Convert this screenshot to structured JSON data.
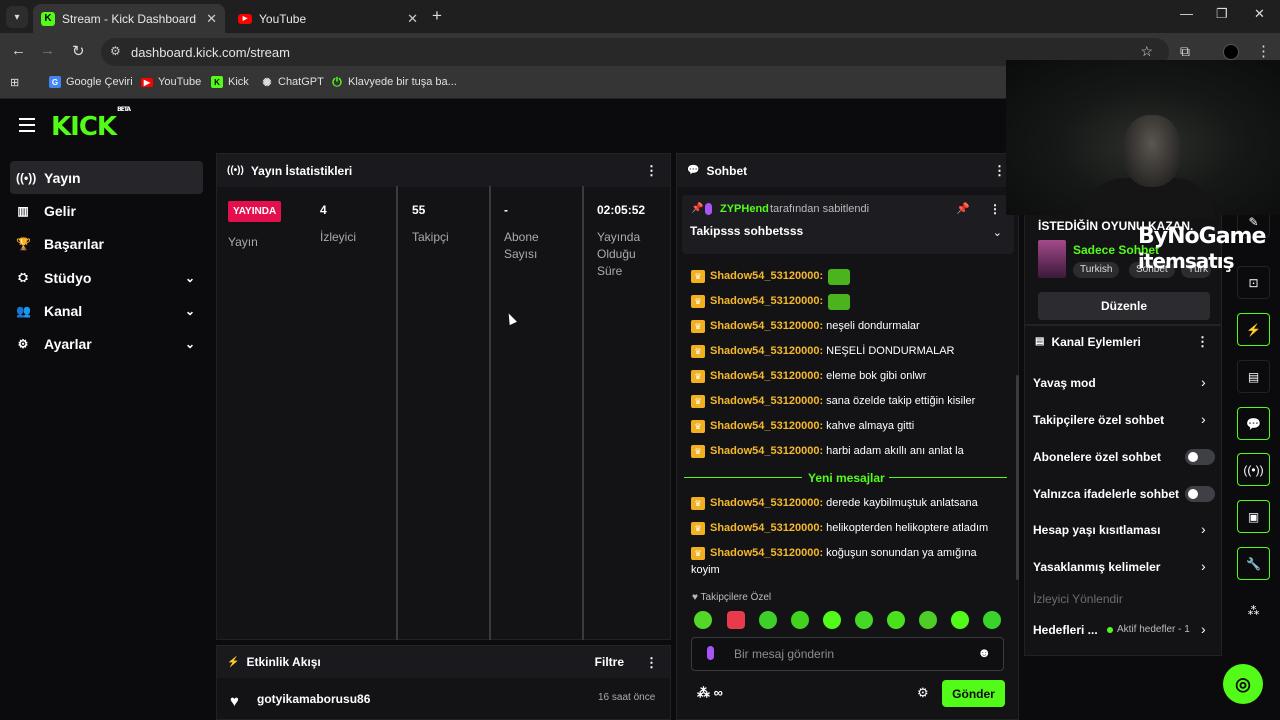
{
  "browser": {
    "tabs": [
      {
        "title": "Stream - Kick Dashboard",
        "active": true
      },
      {
        "title": "YouTube",
        "active": false
      }
    ],
    "url": "dashboard.kick.com/stream",
    "bookmarks": [
      "Google Çeviri",
      "YouTube",
      "Kick",
      "ChatGPT",
      "Klavyede bir tuşa ba..."
    ]
  },
  "brand": {
    "logo": "KICK",
    "beta": "BETA",
    "accent": "#53fc18"
  },
  "sidebar": {
    "items": [
      {
        "label": "Yayın",
        "icon": "broadcast-icon"
      },
      {
        "label": "Gelir",
        "icon": "chart-icon"
      },
      {
        "label": "Başarılar",
        "icon": "trophy-icon"
      },
      {
        "label": "Stüdyo",
        "icon": "studio-icon"
      },
      {
        "label": "Kanal",
        "icon": "users-icon"
      },
      {
        "label": "Ayarlar",
        "icon": "gear-icon"
      }
    ]
  },
  "stats": {
    "title": "Yayın İstatistikleri",
    "live_badge": "YAYINDA",
    "status_label": "Yayın",
    "viewers": {
      "value": "4",
      "label": "İzleyici"
    },
    "followers": {
      "value": "55",
      "label": "Takipçi"
    },
    "subs": {
      "value": "-",
      "label1": "Abone",
      "label2": "Sayısı"
    },
    "uptime": {
      "value": "02:05:52",
      "label1": "Yayında",
      "label2": "Olduğu",
      "label3": "Süre"
    }
  },
  "activity": {
    "title": "Etkinlik Akışı",
    "filter": "Filtre",
    "entry": {
      "user": "gotyikamaborusu86",
      "time": "16 saat önce"
    }
  },
  "chat": {
    "title": "Sohbet",
    "pinned": {
      "user": "ZYPHend",
      "suffix": "tarafından sabitlendi",
      "message": "Takipsss sohbetsss"
    },
    "user": "Shadow54_53120000:",
    "messages": [
      "neşeli dondurmalar",
      "NEŞELİ DONDURMALAR",
      "eleme bok gibi onlwr",
      "sana özelde takip ettiğin kisiler",
      "kahve almaya gitti",
      "harbi adam akıllı anı anlat la"
    ],
    "new_messages_label": "Yeni mesajlar",
    "new_messages": [
      "derede kaybilmuştuk anlatsana",
      "helikopterden helikoptere atladım",
      "koğuşun sonundan ya amığına",
      "koyim"
    ],
    "followers_only_label": "Takipçilere Özel",
    "input_placeholder": "Bir mesaj gönderin",
    "send_label": "Gönder"
  },
  "stream_info": {
    "title": "İSTEDİĞİN OYUNU KAZAN.",
    "category": "Sadece Sohbet",
    "tags": [
      "Turkish",
      "Sohbet",
      "Türk"
    ],
    "edit_label": "Düzenle"
  },
  "channel_actions": {
    "title": "Kanal Eylemleri",
    "items": [
      "Yavaş mod",
      "Takipçilere özel sohbet",
      "Abonelere özel sohbet",
      "Yalnızca ifadelerle sohbet",
      "Hesap yaşı kısıtlaması",
      "Yasaklanmış kelimeler"
    ],
    "section_label": "İzleyici Yönlendir",
    "goals_label": "Hedefleri ...",
    "goals_status": "Aktif hedefler - 1"
  },
  "overlay": {
    "line1": "ByNoGame",
    "line2": "itemsatış"
  }
}
